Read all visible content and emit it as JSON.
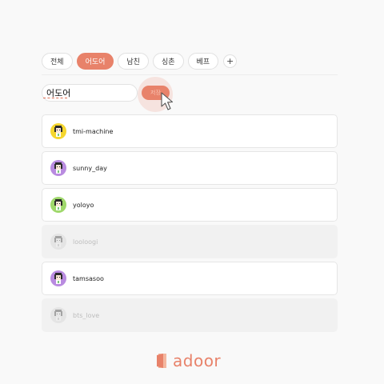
{
  "tabs": [
    {
      "label": "전체",
      "active": false
    },
    {
      "label": "어도어",
      "active": true
    },
    {
      "label": "남친",
      "active": false
    },
    {
      "label": "싱촌",
      "active": false
    },
    {
      "label": "베프",
      "active": false
    }
  ],
  "add_tab_label": "+",
  "group_name_input": {
    "value": "어도어"
  },
  "save_button": {
    "label": "저장",
    "color": "#e8826a"
  },
  "friends": [
    {
      "name": "tmi-machine",
      "avatar_color": "#f5d62e",
      "hidden": false
    },
    {
      "name": "sunny_day",
      "avatar_color": "#b98be0",
      "hidden": false
    },
    {
      "name": "yoloyo",
      "avatar_color": "#9fd86b",
      "hidden": false
    },
    {
      "name": "looloogi",
      "avatar_color": "#e4e4e4",
      "hidden": true
    },
    {
      "name": "tamsasoo",
      "avatar_color": "#b98be0",
      "hidden": false
    },
    {
      "name": "bts_love",
      "avatar_color": "#e4e4e4",
      "hidden": true
    }
  ],
  "brand": {
    "logo_text": "adoor",
    "accent": "#e8826a",
    "icon": "adoor-logo-icon"
  }
}
